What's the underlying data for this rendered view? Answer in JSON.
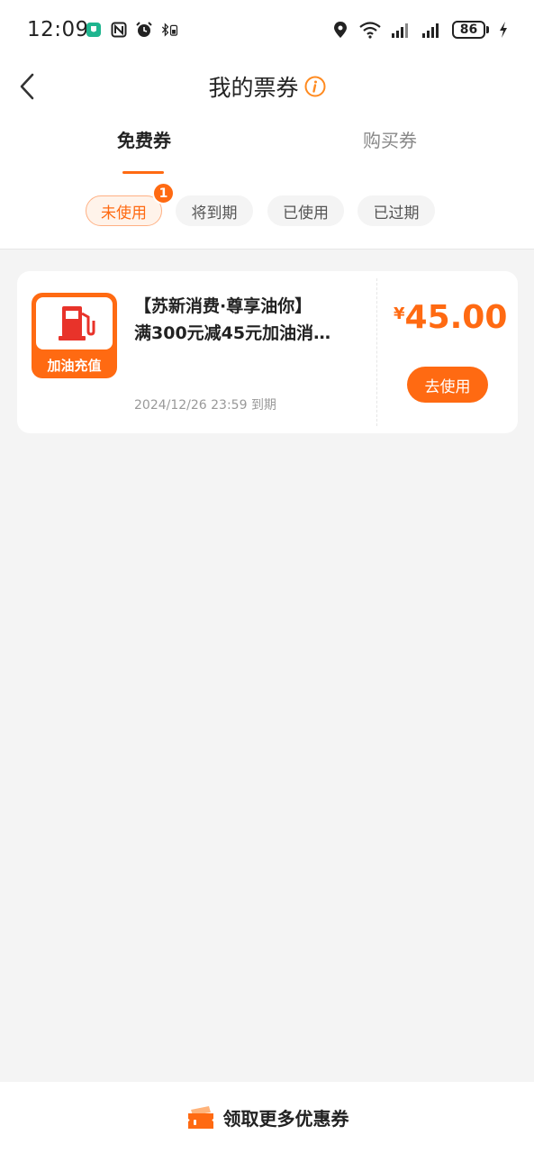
{
  "status_bar": {
    "time": "12:09",
    "battery": "86",
    "icons_left": [
      "shield-app-icon",
      "nfc-icon",
      "alarm-icon",
      "bluetooth-battery-icon"
    ],
    "icons_right": [
      "location-icon",
      "wifi-icon",
      "signal-icon",
      "signal-icon",
      "battery-icon",
      "charging-icon"
    ]
  },
  "header": {
    "title": "我的票券"
  },
  "tabs": [
    {
      "label": "免费券",
      "active": true
    },
    {
      "label": "购买券",
      "active": false
    }
  ],
  "filters": [
    {
      "label": "未使用",
      "active": true,
      "badge": "1"
    },
    {
      "label": "将到期",
      "active": false
    },
    {
      "label": "已使用",
      "active": false
    },
    {
      "label": "已过期",
      "active": false
    }
  ],
  "coupon": {
    "icon_label": "加油充值",
    "title_line1": "【苏新消费·尊享油你】",
    "title_line2": "满300元减45元加油消…",
    "expiry": "2024/12/26 23:59 到期",
    "currency": "¥",
    "amount": "45.00",
    "action_label": "去使用"
  },
  "bottom": {
    "label": "领取更多优惠券"
  },
  "colors": {
    "accent": "#ff6a12",
    "background": "#f4f4f4"
  }
}
